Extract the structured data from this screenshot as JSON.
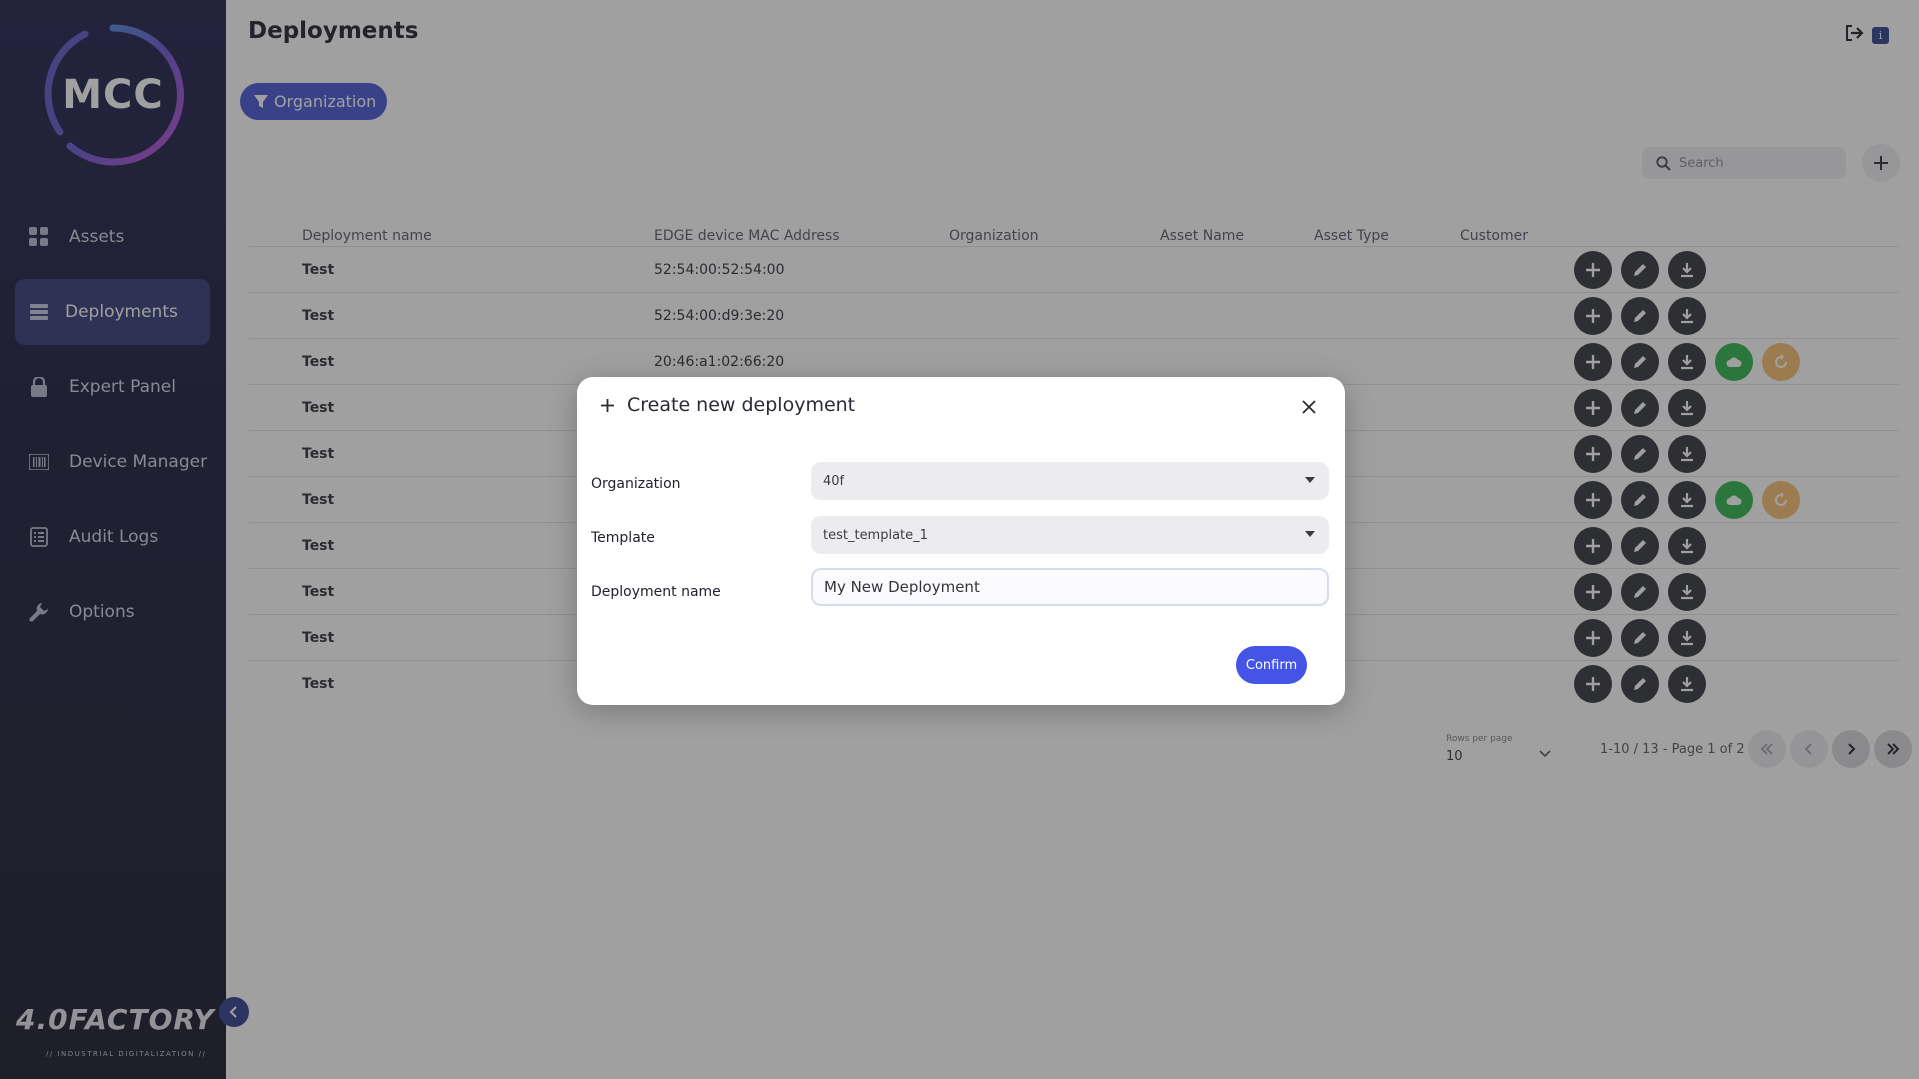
{
  "app": {
    "logo_text": "MCC",
    "brand": "4.0FACTORY",
    "brand_tagline": "// INDUSTRIAL DIGITALIZATION //"
  },
  "sidebar": {
    "items": [
      {
        "label": "Assets",
        "icon": "grid-icon",
        "active": false
      },
      {
        "label": "Deployments",
        "icon": "list-icon",
        "active": true
      },
      {
        "label": "Expert Panel",
        "icon": "lock-icon",
        "active": false
      },
      {
        "label": "Device Manager",
        "icon": "barcode-icon",
        "active": false
      },
      {
        "label": "Audit Logs",
        "icon": "log-icon",
        "active": false
      },
      {
        "label": "Options",
        "icon": "wrench-icon",
        "active": false
      }
    ]
  },
  "header": {
    "title": "Deployments",
    "info_badge": "i"
  },
  "filter": {
    "label": "Organization"
  },
  "search": {
    "placeholder": "Search"
  },
  "table": {
    "columns": [
      "Deployment name",
      "EDGE device MAC Address",
      "Organization",
      "Asset Name",
      "Asset Type",
      "Customer"
    ],
    "rows": [
      {
        "name": "Test",
        "mac": "52:54:00:52:54:00",
        "extra": false
      },
      {
        "name": "Test",
        "mac": "52:54:00:d9:3e:20",
        "extra": false
      },
      {
        "name": "Test",
        "mac": "20:46:a1:02:66:20",
        "extra": true
      },
      {
        "name": "Test",
        "mac": "",
        "extra": false
      },
      {
        "name": "Test",
        "mac": "",
        "extra": false
      },
      {
        "name": "Test",
        "mac": "",
        "extra": true
      },
      {
        "name": "Test",
        "mac": "",
        "extra": false
      },
      {
        "name": "Test",
        "mac": "",
        "extra": false
      },
      {
        "name": "Test",
        "mac": "",
        "extra": false
      },
      {
        "name": "Test",
        "mac": "",
        "extra": false
      }
    ]
  },
  "pagination": {
    "rows_per_page_label": "Rows per page",
    "rows_per_page": "10",
    "info": "1-10 / 13 - Page 1 of 2"
  },
  "modal": {
    "title": "Create new deployment",
    "fields": {
      "organization_label": "Organization",
      "organization_value": "40f",
      "template_label": "Template",
      "template_value": "test_template_1",
      "name_label": "Deployment name",
      "name_value": "My New Deployment"
    },
    "confirm_label": "Confirm"
  },
  "colors": {
    "accent": "#4454e6",
    "sidebar_bg": "#17173a",
    "green": "#28b34a",
    "orange": "#f6bd6e"
  }
}
